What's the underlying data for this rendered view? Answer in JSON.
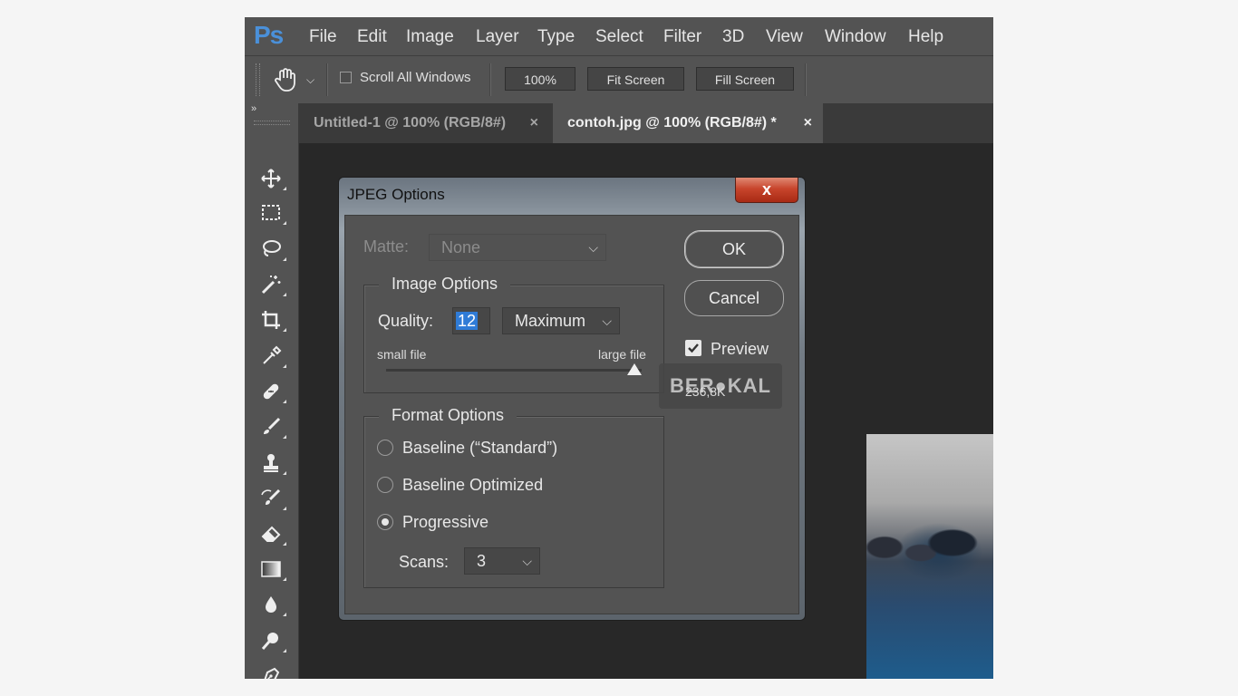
{
  "app": {
    "logo": "Ps",
    "menu": [
      "File",
      "Edit",
      "Image",
      "Layer",
      "Type",
      "Select",
      "Filter",
      "3D",
      "View",
      "Window",
      "Help"
    ]
  },
  "options_bar": {
    "scroll_all_windows": "Scroll All Windows",
    "zoom": "100%",
    "fit_screen": "Fit Screen",
    "fill_screen": "Fill Screen"
  },
  "tabs": [
    {
      "label": "Untitled-1 @ 100% (RGB/8#)",
      "close": "×",
      "active": false
    },
    {
      "label": "contoh.jpg @ 100% (RGB/8#) *",
      "close": "×",
      "active": true
    }
  ],
  "tools": [
    "move-tool-icon",
    "marquee-tool-icon",
    "lasso-tool-icon",
    "magic-wand-icon",
    "crop-tool-icon",
    "eyedropper-icon",
    "healing-brush-icon",
    "brush-tool-icon",
    "clone-stamp-icon",
    "history-brush-icon",
    "eraser-icon",
    "gradient-tool-icon",
    "blur-tool-icon",
    "dodge-tool-icon",
    "pen-tool-icon"
  ],
  "dialog": {
    "title": "JPEG Options",
    "close": "x",
    "matte_label": "Matte:",
    "matte_value": "None",
    "image_options_title": "Image Options",
    "quality_label": "Quality:",
    "quality_value": "12",
    "quality_preset": "Maximum",
    "small_file": "small file",
    "large_file": "large file",
    "quality_slider_fraction": 1.0,
    "format_options_title": "Format Options",
    "format_options": [
      {
        "label": "Baseline (“Standard”)",
        "selected": false
      },
      {
        "label": "Baseline Optimized",
        "selected": false
      },
      {
        "label": "Progressive",
        "selected": true
      }
    ],
    "scans_label": "Scans:",
    "scans_value": "3",
    "ok": "OK",
    "cancel": "Cancel",
    "preview_label": "Preview",
    "preview_checked": true,
    "file_size": "236,8K"
  },
  "watermark": "BER●KAL",
  "colors": {
    "accent": "#2f7bd6",
    "panel": "#535353",
    "canvas": "#282828"
  }
}
